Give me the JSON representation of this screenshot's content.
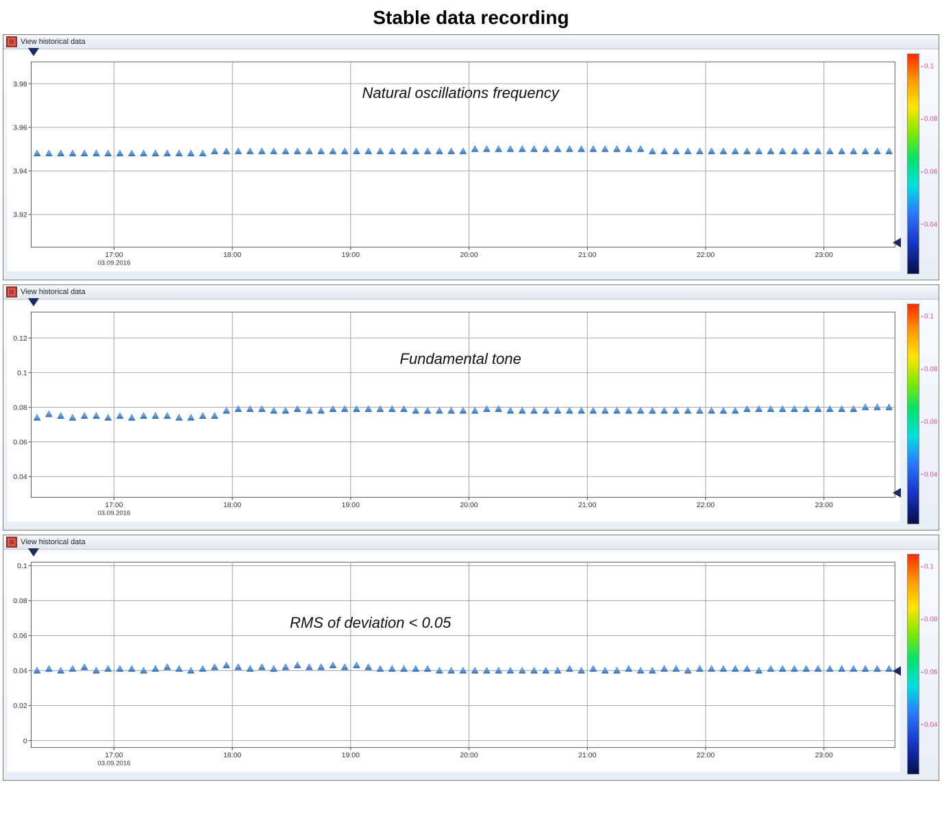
{
  "page_title": "Stable data recording",
  "panel_header_text": "View historical data",
  "colorbar": {
    "ticks": [
      "0.1",
      "0.08",
      "0.06",
      "0.04"
    ],
    "positions_pct": [
      6,
      30,
      54,
      78
    ]
  },
  "chart_data": [
    {
      "type": "scatter",
      "title": "",
      "annotation": "Natural oscillations frequency",
      "xlabel": "",
      "ylabel": "",
      "x_ticks": [
        "17:00",
        "18:00",
        "19:00",
        "20:00",
        "21:00",
        "22:00",
        "23:00"
      ],
      "x_date": "03.09.2016",
      "y_ticks": [
        3.92,
        3.94,
        3.96,
        3.98
      ],
      "ylim": [
        3.905,
        3.99
      ],
      "x_num_range": [
        16.3,
        23.6
      ],
      "annotation_pos": {
        "x_pct": 48,
        "y_pct": 20
      },
      "end_marker_y_pct": 97,
      "x": [
        16.35,
        16.45,
        16.55,
        16.65,
        16.75,
        16.85,
        16.95,
        17.05,
        17.15,
        17.25,
        17.35,
        17.45,
        17.55,
        17.65,
        17.75,
        17.85,
        17.95,
        18.05,
        18.15,
        18.25,
        18.35,
        18.45,
        18.55,
        18.65,
        18.75,
        18.85,
        18.95,
        19.05,
        19.15,
        19.25,
        19.35,
        19.45,
        19.55,
        19.65,
        19.75,
        19.85,
        19.95,
        20.05,
        20.15,
        20.25,
        20.35,
        20.45,
        20.55,
        20.65,
        20.75,
        20.85,
        20.95,
        21.05,
        21.15,
        21.25,
        21.35,
        21.45,
        21.55,
        21.65,
        21.75,
        21.85,
        21.95,
        22.05,
        22.15,
        22.25,
        22.35,
        22.45,
        22.55,
        22.65,
        22.75,
        22.85,
        22.95,
        23.05,
        23.15,
        23.25,
        23.35,
        23.45,
        23.55
      ],
      "y": [
        3.948,
        3.948,
        3.948,
        3.948,
        3.948,
        3.948,
        3.948,
        3.948,
        3.948,
        3.948,
        3.948,
        3.948,
        3.948,
        3.948,
        3.948,
        3.949,
        3.949,
        3.949,
        3.949,
        3.949,
        3.949,
        3.949,
        3.949,
        3.949,
        3.949,
        3.949,
        3.949,
        3.949,
        3.949,
        3.949,
        3.949,
        3.949,
        3.949,
        3.949,
        3.949,
        3.949,
        3.949,
        3.95,
        3.95,
        3.95,
        3.95,
        3.95,
        3.95,
        3.95,
        3.95,
        3.95,
        3.95,
        3.95,
        3.95,
        3.95,
        3.95,
        3.95,
        3.949,
        3.949,
        3.949,
        3.949,
        3.949,
        3.949,
        3.949,
        3.949,
        3.949,
        3.949,
        3.949,
        3.949,
        3.949,
        3.949,
        3.949,
        3.949,
        3.949,
        3.949,
        3.949,
        3.949,
        3.949
      ]
    },
    {
      "type": "scatter",
      "title": "",
      "annotation": "Fundamental tone",
      "xlabel": "",
      "ylabel": "",
      "x_ticks": [
        "17:00",
        "18:00",
        "19:00",
        "20:00",
        "21:00",
        "22:00",
        "23:00"
      ],
      "x_date": "03.09.2016",
      "y_ticks": [
        0.04,
        0.06,
        0.08,
        0.1,
        0.12
      ],
      "ylim": [
        0.028,
        0.135
      ],
      "x_num_range": [
        16.3,
        23.6
      ],
      "annotation_pos": {
        "x_pct": 48,
        "y_pct": 28
      },
      "end_marker_y_pct": 97,
      "x": [
        16.35,
        16.45,
        16.55,
        16.65,
        16.75,
        16.85,
        16.95,
        17.05,
        17.15,
        17.25,
        17.35,
        17.45,
        17.55,
        17.65,
        17.75,
        17.85,
        17.95,
        18.05,
        18.15,
        18.25,
        18.35,
        18.45,
        18.55,
        18.65,
        18.75,
        18.85,
        18.95,
        19.05,
        19.15,
        19.25,
        19.35,
        19.45,
        19.55,
        19.65,
        19.75,
        19.85,
        19.95,
        20.05,
        20.15,
        20.25,
        20.35,
        20.45,
        20.55,
        20.65,
        20.75,
        20.85,
        20.95,
        21.05,
        21.15,
        21.25,
        21.35,
        21.45,
        21.55,
        21.65,
        21.75,
        21.85,
        21.95,
        22.05,
        22.15,
        22.25,
        22.35,
        22.45,
        22.55,
        22.65,
        22.75,
        22.85,
        22.95,
        23.05,
        23.15,
        23.25,
        23.35,
        23.45,
        23.55
      ],
      "y": [
        0.074,
        0.076,
        0.075,
        0.074,
        0.075,
        0.075,
        0.074,
        0.075,
        0.074,
        0.075,
        0.075,
        0.075,
        0.074,
        0.074,
        0.075,
        0.075,
        0.078,
        0.079,
        0.079,
        0.079,
        0.078,
        0.078,
        0.079,
        0.078,
        0.078,
        0.079,
        0.079,
        0.079,
        0.079,
        0.079,
        0.079,
        0.079,
        0.078,
        0.078,
        0.078,
        0.078,
        0.078,
        0.078,
        0.079,
        0.079,
        0.078,
        0.078,
        0.078,
        0.078,
        0.078,
        0.078,
        0.078,
        0.078,
        0.078,
        0.078,
        0.078,
        0.078,
        0.078,
        0.078,
        0.078,
        0.078,
        0.078,
        0.078,
        0.078,
        0.078,
        0.079,
        0.079,
        0.079,
        0.079,
        0.079,
        0.079,
        0.079,
        0.079,
        0.079,
        0.079,
        0.08,
        0.08,
        0.08
      ]
    },
    {
      "type": "scatter",
      "title": "",
      "annotation": "RMS of deviation < 0.05",
      "xlabel": "",
      "ylabel": "",
      "x_ticks": [
        "17:00",
        "18:00",
        "19:00",
        "20:00",
        "21:00",
        "22:00",
        "23:00"
      ],
      "x_date": "03.09.2016",
      "y_ticks": [
        0,
        0.02,
        0.04,
        0.06,
        0.08,
        0.1
      ],
      "ylim": [
        -0.004,
        0.102
      ],
      "x_num_range": [
        16.3,
        23.6
      ],
      "annotation_pos": {
        "x_pct": 38,
        "y_pct": 35
      },
      "end_marker_y_pct": 60,
      "x": [
        16.35,
        16.45,
        16.55,
        16.65,
        16.75,
        16.85,
        16.95,
        17.05,
        17.15,
        17.25,
        17.35,
        17.45,
        17.55,
        17.65,
        17.75,
        17.85,
        17.95,
        18.05,
        18.15,
        18.25,
        18.35,
        18.45,
        18.55,
        18.65,
        18.75,
        18.85,
        18.95,
        19.05,
        19.15,
        19.25,
        19.35,
        19.45,
        19.55,
        19.65,
        19.75,
        19.85,
        19.95,
        20.05,
        20.15,
        20.25,
        20.35,
        20.45,
        20.55,
        20.65,
        20.75,
        20.85,
        20.95,
        21.05,
        21.15,
        21.25,
        21.35,
        21.45,
        21.55,
        21.65,
        21.75,
        21.85,
        21.95,
        22.05,
        22.15,
        22.25,
        22.35,
        22.45,
        22.55,
        22.65,
        22.75,
        22.85,
        22.95,
        23.05,
        23.15,
        23.25,
        23.35,
        23.45,
        23.55
      ],
      "y": [
        0.04,
        0.041,
        0.04,
        0.041,
        0.042,
        0.04,
        0.041,
        0.041,
        0.041,
        0.04,
        0.041,
        0.042,
        0.041,
        0.04,
        0.041,
        0.042,
        0.043,
        0.042,
        0.041,
        0.042,
        0.041,
        0.042,
        0.043,
        0.042,
        0.042,
        0.043,
        0.042,
        0.043,
        0.042,
        0.041,
        0.041,
        0.041,
        0.041,
        0.041,
        0.04,
        0.04,
        0.04,
        0.04,
        0.04,
        0.04,
        0.04,
        0.04,
        0.04,
        0.04,
        0.04,
        0.041,
        0.04,
        0.041,
        0.04,
        0.04,
        0.041,
        0.04,
        0.04,
        0.041,
        0.041,
        0.04,
        0.041,
        0.041,
        0.041,
        0.041,
        0.041,
        0.04,
        0.041,
        0.041,
        0.041,
        0.041,
        0.041,
        0.041,
        0.041,
        0.041,
        0.041,
        0.041,
        0.041
      ]
    }
  ]
}
